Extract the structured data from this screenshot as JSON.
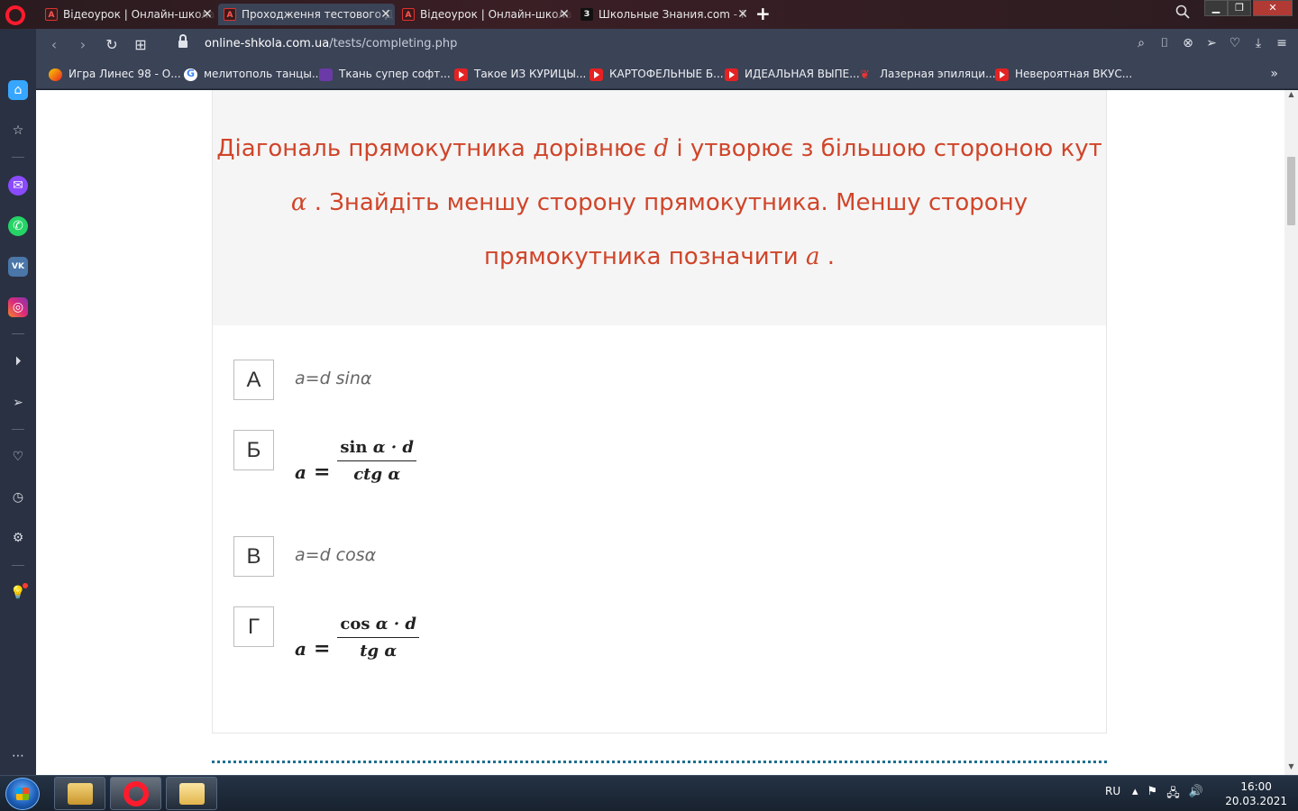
{
  "browser": {
    "tabs": [
      {
        "title": "Відеоурок | Онлайн-школа",
        "icon": "adobe-pdf-icon",
        "active": false
      },
      {
        "title": "Проходження тестового Д",
        "icon": "adobe-pdf-icon",
        "active": true
      },
      {
        "title": "Відеоурок | Онлайн-школа",
        "icon": "adobe-pdf-icon",
        "active": false
      },
      {
        "title": "Школьные Знания.com - F",
        "icon": "znanija-icon",
        "active": false
      }
    ],
    "close_symbol": "✕",
    "new_tab_symbol": "+",
    "url": {
      "host": "online-shkola.com.ua",
      "path": "/tests/completing.php"
    },
    "bookmarks": [
      {
        "label": "Игра Линес 98 - О...",
        "icon": "lines-icon"
      },
      {
        "label": "мелитополь танцы...",
        "icon": "google-icon"
      },
      {
        "label": "Ткань супер софт...",
        "icon": "purple-square-icon"
      },
      {
        "label": "Такое ИЗ КУРИЦЫ...",
        "icon": "youtube-icon"
      },
      {
        "label": "КАРТОФЕЛЬНЫЕ Б...",
        "icon": "youtube-icon"
      },
      {
        "label": "ИДЕАЛЬНАЯ ВЫПЕ...",
        "icon": "youtube-icon"
      },
      {
        "label": "Лазерная эпиляци...",
        "icon": "butterfly-icon"
      },
      {
        "label": "Невероятная ВКУС...",
        "icon": "youtube-icon"
      }
    ],
    "more_symbol": "»"
  },
  "question": {
    "part1": "Діагональ прямокутника дорівнює ",
    "var_d": "d",
    "part2": "  і утворює з більшою стороною кут",
    "var_alpha": "α",
    "part3": " . Знайдіть меншу сторону прямокутника. Меншу сторону",
    "part4": "прямокутника позначити ",
    "var_a": "a",
    "part5": " ."
  },
  "answers": [
    {
      "letter": "А",
      "text": "a=d sinα"
    },
    {
      "letter": "Б",
      "formula": {
        "lhs": "a",
        "eq": "=",
        "num_fn": "sin",
        "num_rest": " α · d",
        "den": "ctg  α"
      }
    },
    {
      "letter": "В",
      "text": "a=d cosα"
    },
    {
      "letter": "Г",
      "formula": {
        "lhs": "a",
        "eq": "=",
        "num_fn": "cos",
        "num_rest": " α · d",
        "den": "tg  α"
      }
    }
  ],
  "taskbar": {
    "lang": "RU",
    "time": "16:00",
    "date": "20.03.2021"
  },
  "colors": {
    "question_text": "#d0452a",
    "browser_chrome": "#3b4356",
    "sidebar": "#2a3142"
  }
}
